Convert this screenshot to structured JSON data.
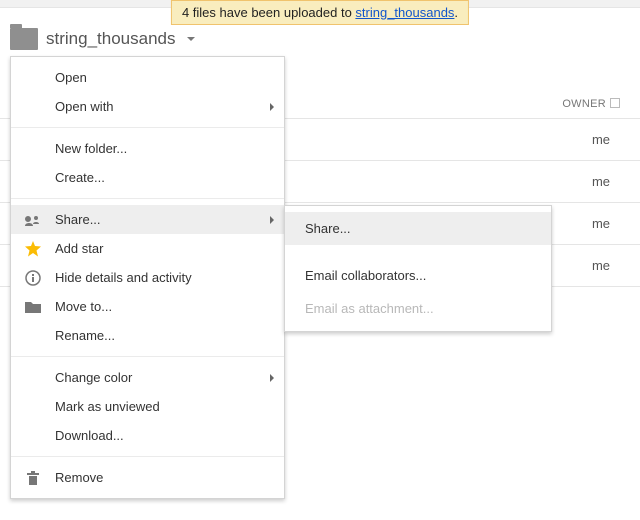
{
  "notification": {
    "prefix": "4 files have been uploaded to ",
    "link": "string_thousands",
    "suffix": "."
  },
  "breadcrumb": {
    "folder_name": "string_thousands"
  },
  "listing": {
    "header_owner": "OWNER",
    "rows": [
      {
        "owner": "me"
      },
      {
        "owner": "me"
      },
      {
        "owner": "me"
      },
      {
        "owner": "me"
      }
    ]
  },
  "menu": {
    "open": "Open",
    "open_with": "Open with",
    "new_folder": "New folder...",
    "create": "Create...",
    "share": "Share...",
    "add_star": "Add star",
    "hide_details": "Hide details and activity",
    "move_to": "Move to...",
    "rename": "Rename...",
    "change_color": "Change color",
    "mark_unviewed": "Mark as unviewed",
    "download": "Download...",
    "remove": "Remove"
  },
  "submenu": {
    "share": "Share...",
    "email_collab": "Email collaborators...",
    "email_attach": "Email as attachment..."
  }
}
